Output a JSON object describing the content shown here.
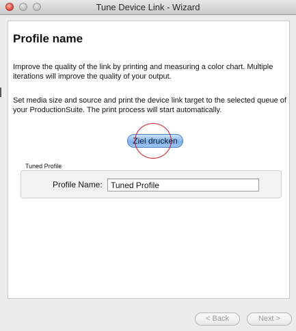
{
  "window": {
    "title": "Tune Device Link - Wizard"
  },
  "page": {
    "heading": "Profile name",
    "paragraph_1": "Improve the quality of the link by printing and measuring a color chart. Multiple iterations will improve the quality of your output.",
    "paragraph_2": "Set media size and source and print the device link target to the selected queue of your ProductionSuite. The print process will start automatically.",
    "print_button_label": "Ziel drucken"
  },
  "tuned_profile": {
    "group_label": "Tuned Profile",
    "field_label": "Profile Name:",
    "field_value": "Tuned Profile"
  },
  "navigation": {
    "back_label": "< Back",
    "next_label": "Next >"
  },
  "colors": {
    "accent": "#7fb2ee",
    "click_marker": "#d2151b"
  }
}
